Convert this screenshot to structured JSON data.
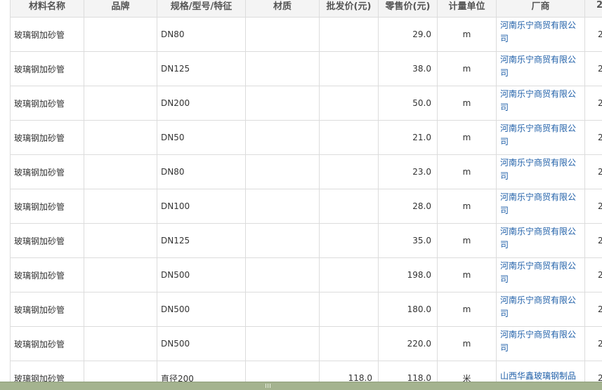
{
  "table": {
    "headers": [
      "材料名称",
      "品牌",
      "规格/型号/特征",
      "材质",
      "批发价(元)",
      "零售价(元)",
      "计量单位",
      "厂商",
      "2"
    ],
    "rows": [
      {
        "name": "玻璃钢加砂管",
        "brand": "",
        "spec": "DN80",
        "material": "",
        "wholesale": "",
        "retail": "29.0",
        "unit": "m",
        "vendor": "河南乐宁商贸有限公司",
        "extra": "2"
      },
      {
        "name": "玻璃钢加砂管",
        "brand": "",
        "spec": "DN125",
        "material": "",
        "wholesale": "",
        "retail": "38.0",
        "unit": "m",
        "vendor": "河南乐宁商贸有限公司",
        "extra": "2"
      },
      {
        "name": "玻璃钢加砂管",
        "brand": "",
        "spec": "DN200",
        "material": "",
        "wholesale": "",
        "retail": "50.0",
        "unit": "m",
        "vendor": "河南乐宁商贸有限公司",
        "extra": "2"
      },
      {
        "name": "玻璃钢加砂管",
        "brand": "",
        "spec": "DN50",
        "material": "",
        "wholesale": "",
        "retail": "21.0",
        "unit": "m",
        "vendor": "河南乐宁商贸有限公司",
        "extra": "2"
      },
      {
        "name": "玻璃钢加砂管",
        "brand": "",
        "spec": "DN80",
        "material": "",
        "wholesale": "",
        "retail": "23.0",
        "unit": "m",
        "vendor": "河南乐宁商贸有限公司",
        "extra": "2"
      },
      {
        "name": "玻璃钢加砂管",
        "brand": "",
        "spec": "DN100",
        "material": "",
        "wholesale": "",
        "retail": "28.0",
        "unit": "m",
        "vendor": "河南乐宁商贸有限公司",
        "extra": "2"
      },
      {
        "name": "玻璃钢加砂管",
        "brand": "",
        "spec": "DN125",
        "material": "",
        "wholesale": "",
        "retail": "35.0",
        "unit": "m",
        "vendor": "河南乐宁商贸有限公司",
        "extra": "2"
      },
      {
        "name": "玻璃钢加砂管",
        "brand": "",
        "spec": "DN500",
        "material": "",
        "wholesale": "",
        "retail": "198.0",
        "unit": "m",
        "vendor": "河南乐宁商贸有限公司",
        "extra": "2"
      },
      {
        "name": "玻璃钢加砂管",
        "brand": "",
        "spec": "DN500",
        "material": "",
        "wholesale": "",
        "retail": "180.0",
        "unit": "m",
        "vendor": "河南乐宁商贸有限公司",
        "extra": "2"
      },
      {
        "name": "玻璃钢加砂管",
        "brand": "",
        "spec": "DN500",
        "material": "",
        "wholesale": "",
        "retail": "220.0",
        "unit": "m",
        "vendor": "河南乐宁商贸有限公司",
        "extra": "2"
      },
      {
        "name": "玻璃钢加砂管",
        "brand": "",
        "spec": "直径200",
        "material": "",
        "wholesale": "118.0",
        "retail": "118.0",
        "unit": "米",
        "vendor": "山西华鑫玻璃钢制品",
        "extra": "2"
      }
    ]
  },
  "colors": {
    "name_text": "#dd1111",
    "vendor_link": "#1f5fa8",
    "header_bg": "#f4f4f4",
    "bottom_bar": "#a4b38f"
  }
}
